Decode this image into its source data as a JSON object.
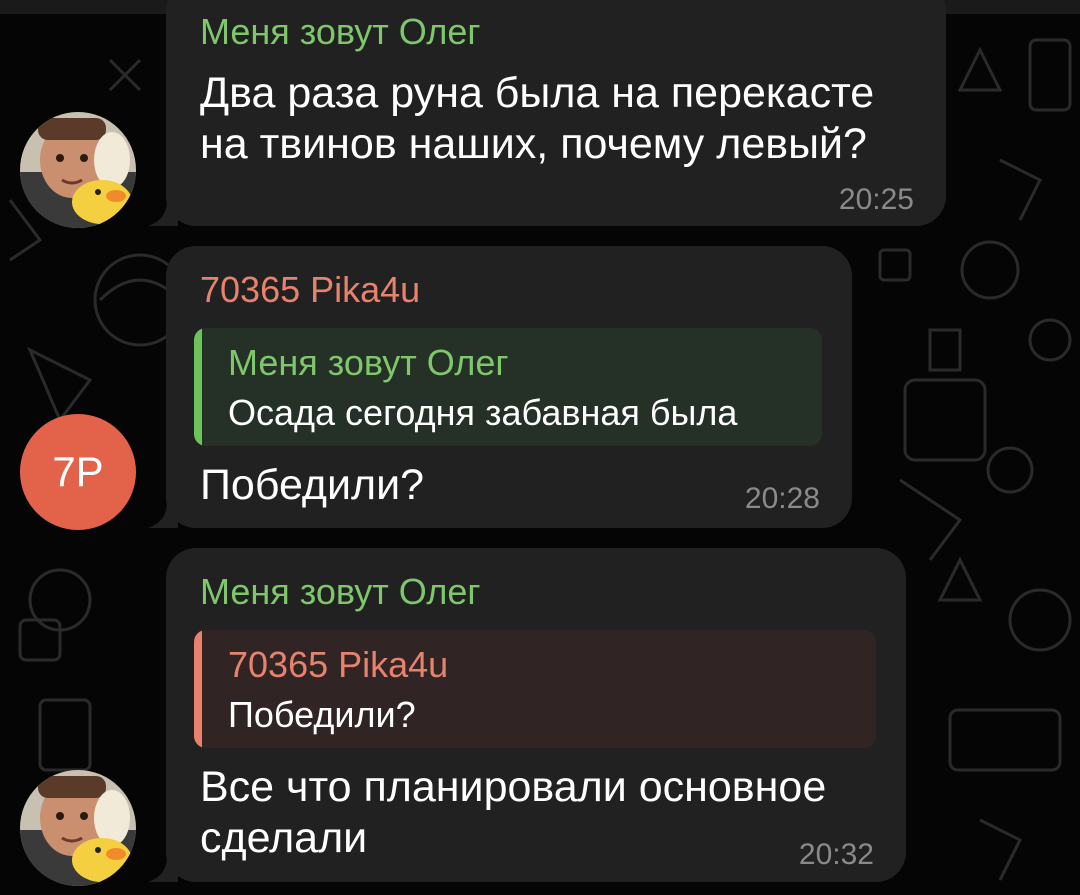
{
  "messages": [
    {
      "sender": "Меня зовут Олег",
      "text_lines": [
        "Два раза руна была на перекасте",
        "на твинов наших, почему левый?"
      ],
      "time": "20:25"
    },
    {
      "sender": "70365 Pika4u",
      "reply": {
        "name": "Меня зовут Олег",
        "text": "Осада сегодня забавная была"
      },
      "text_lines": [
        "Победили?"
      ],
      "time": "20:28",
      "avatar_initials": "7P"
    },
    {
      "sender": "Меня зовут Олег",
      "reply": {
        "name": "70365 Pika4u",
        "text": "Победили?"
      },
      "text_lines": [
        "Все что планировали основное",
        "сделали"
      ],
      "time": "20:32"
    }
  ],
  "colors": {
    "background": "#050505",
    "bubble": "#212121",
    "sender_green": "#7fc76b",
    "sender_orange": "#e9826c",
    "avatar_7p": "#e2634a"
  }
}
